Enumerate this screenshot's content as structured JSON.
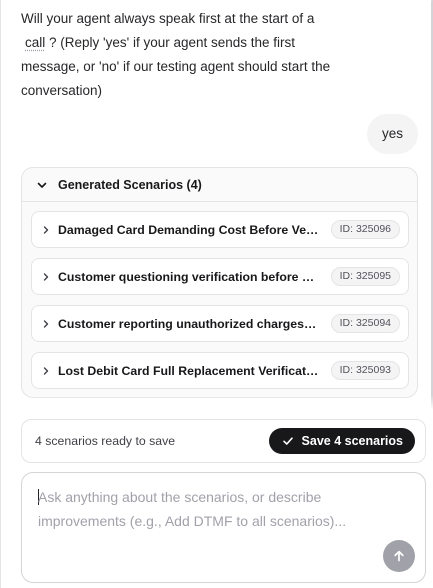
{
  "conversation": {
    "agent_message": {
      "line1": "Will your agent always speak first at the start of a",
      "call_word": "call",
      "line2_rest": "? (Reply 'yes' if your agent sends the first",
      "line3": "message, or 'no' if our testing agent should start the",
      "line4": "conversation)"
    },
    "user_reply": "yes"
  },
  "scenarios": {
    "header_label": "Generated Scenarios (4)",
    "items": [
      {
        "title": "Damaged Card Demanding Cost Before Verification",
        "id_label": "ID: 325096"
      },
      {
        "title": "Customer questioning verification before replacement",
        "id_label": "ID: 325095"
      },
      {
        "title": "Customer reporting unauthorized charges and lost card",
        "id_label": "ID: 325094"
      },
      {
        "title": "Lost Debit Card Full Replacement Verification",
        "id_label": "ID: 325093"
      }
    ]
  },
  "save_bar": {
    "status": "4 scenarios ready to save",
    "button_label": "Save 4 scenarios"
  },
  "composer": {
    "placeholder": "Ask anything about the scenarios, or describe improvements (e.g., Add DTMF to all scenarios)..."
  },
  "icons": {
    "collapse": "chevron-down-icon",
    "expand": "chevron-right-icon",
    "save": "check-icon",
    "send": "arrow-up-icon"
  },
  "colors": {
    "primary_button": "#18181b",
    "send_button": "#a1a1aa",
    "user_bubble": "#f4f4f5"
  }
}
